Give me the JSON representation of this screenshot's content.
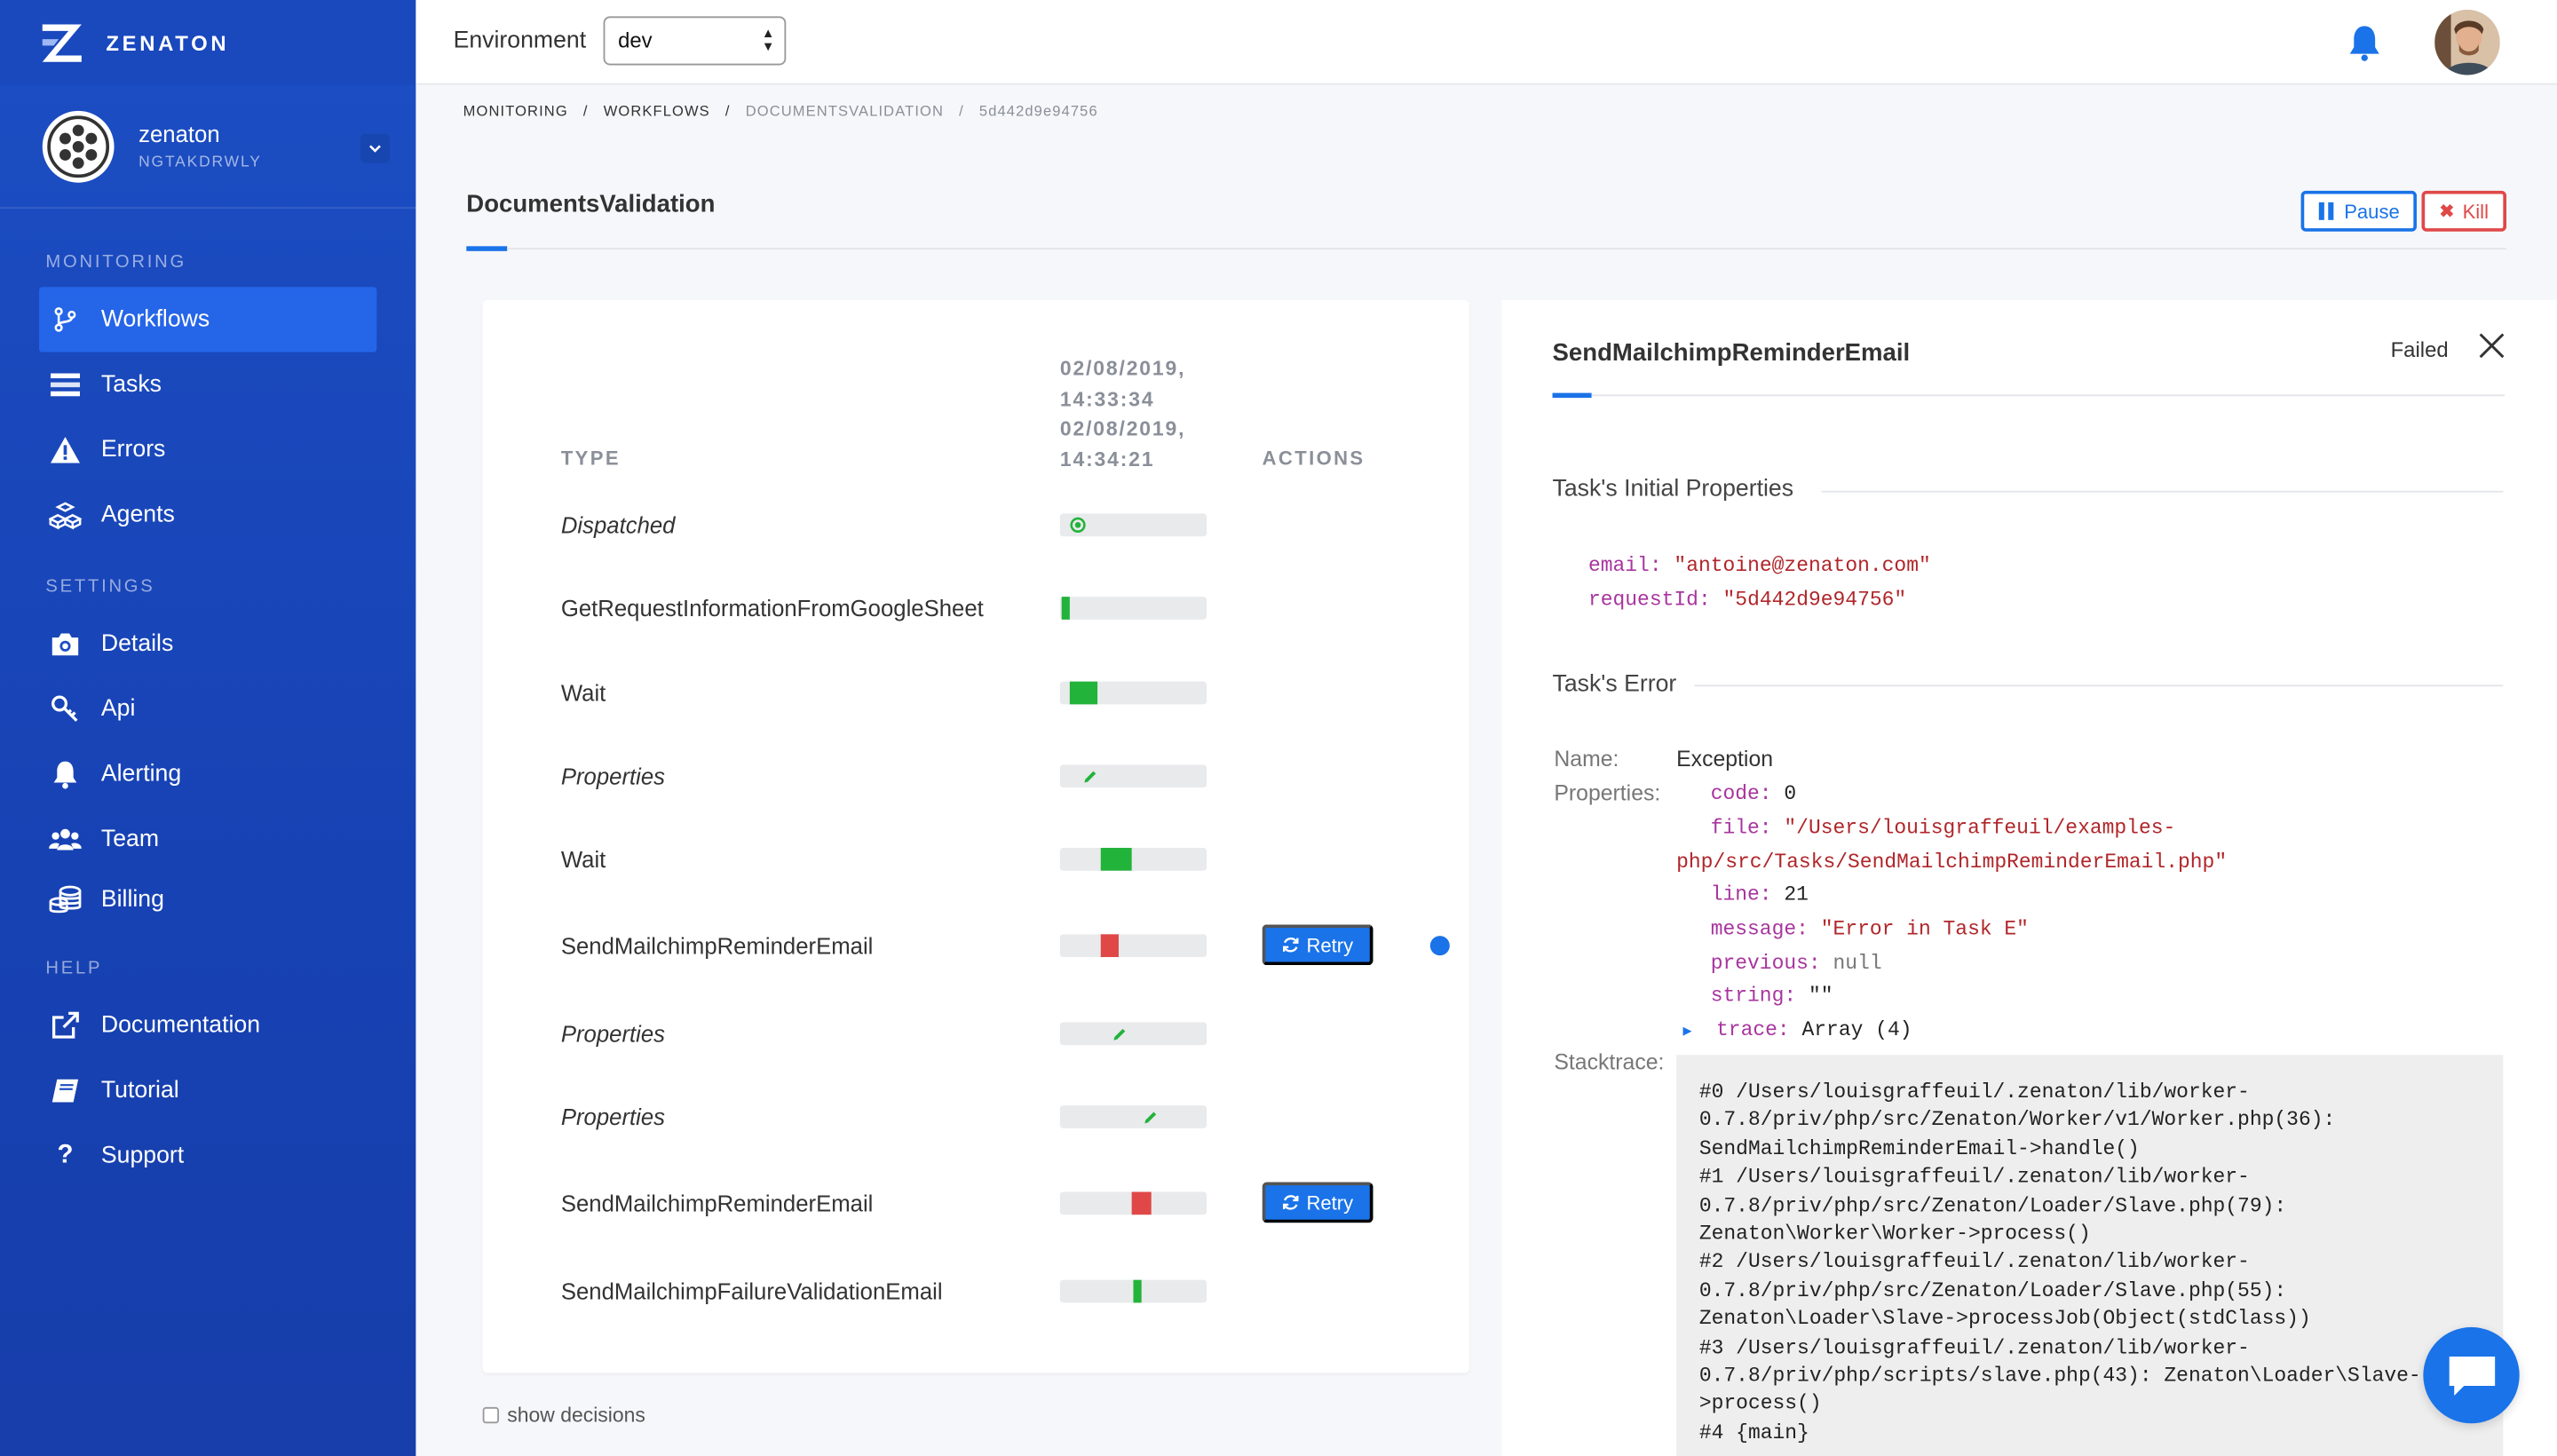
{
  "brand": {
    "name": "ZENATON"
  },
  "account": {
    "name": "zenaton",
    "id": "NGTAKDRWLY"
  },
  "sidebar": {
    "sections": [
      {
        "title": "MONITORING",
        "items": [
          {
            "label": "Workflows",
            "icon": "branch-icon",
            "active": true
          },
          {
            "label": "Tasks",
            "icon": "tasks-icon"
          },
          {
            "label": "Errors",
            "icon": "warning-icon"
          },
          {
            "label": "Agents",
            "icon": "cubes-icon"
          }
        ]
      },
      {
        "title": "SETTINGS",
        "items": [
          {
            "label": "Details",
            "icon": "camera-icon"
          },
          {
            "label": "Api",
            "icon": "key-icon"
          },
          {
            "label": "Alerting",
            "icon": "bell-icon"
          },
          {
            "label": "Team",
            "icon": "team-icon"
          },
          {
            "label": "Billing",
            "icon": "coins-icon"
          }
        ]
      },
      {
        "title": "HELP",
        "items": [
          {
            "label": "Documentation",
            "icon": "external-link-icon"
          },
          {
            "label": "Tutorial",
            "icon": "book-icon"
          },
          {
            "label": "Support",
            "icon": "question-icon"
          }
        ]
      }
    ]
  },
  "header": {
    "env_label": "Environment",
    "env_value": "dev"
  },
  "breadcrumb": [
    "MONITORING",
    "WORKFLOWS",
    "DOCUMENTSVALIDATION",
    "5d442d9e94756"
  ],
  "page": {
    "title": "DocumentsValidation",
    "pause_label": "Pause",
    "kill_label": "Kill"
  },
  "timeline": {
    "col_type": "TYPE",
    "col_actions": "ACTIONS",
    "dates": [
      "02/08/2019,",
      "14:33:34",
      "02/08/2019,",
      "14:34:21"
    ],
    "retry_label": "Retry",
    "rows": [
      {
        "name": "Dispatched",
        "italic": true,
        "kind": "start",
        "pos": 0.08
      },
      {
        "name": "GetRequestInformationFromGoogleSheet",
        "italic": false,
        "kind": "bar",
        "start": 0.01,
        "len": 0.06,
        "color": "#22b33a"
      },
      {
        "name": "Wait",
        "italic": false,
        "kind": "bar",
        "start": 0.07,
        "len": 0.19,
        "color": "#22b33a"
      },
      {
        "name": "Properties",
        "italic": true,
        "kind": "pencil",
        "pos": 0.14
      },
      {
        "name": "Wait",
        "italic": false,
        "kind": "bar",
        "start": 0.28,
        "len": 0.21,
        "color": "#22b33a"
      },
      {
        "name": "SendMailchimpReminderEmail",
        "italic": false,
        "kind": "bar",
        "start": 0.28,
        "len": 0.12,
        "color": "#e04848",
        "retry": true,
        "dot": true
      },
      {
        "name": "Properties",
        "italic": true,
        "kind": "pencil",
        "pos": 0.35
      },
      {
        "name": "Properties",
        "italic": true,
        "kind": "pencil",
        "pos": 0.56
      },
      {
        "name": "SendMailchimpReminderEmail",
        "italic": false,
        "kind": "bar",
        "start": 0.49,
        "len": 0.13,
        "color": "#e04848",
        "retry": true
      },
      {
        "name": "SendMailchimpFailureValidationEmail",
        "italic": false,
        "kind": "bar",
        "start": 0.5,
        "len": 0.06,
        "color": "#22b33a"
      }
    ],
    "show_decisions": "show decisions"
  },
  "task": {
    "title": "SendMailchimpReminderEmail",
    "status": "Failed",
    "initial_title": "Task's Initial Properties",
    "email_key": "email:",
    "email_val": "\"antoine@zenaton.com\"",
    "reqid_key": "requestId:",
    "reqid_val": "\"5d442d9e94756\"",
    "error_title": "Task's Error",
    "name_label": "Name:",
    "name_value": "Exception",
    "props_label": "Properties:",
    "code_key": "code:",
    "code_val": "0",
    "file_key": "file:",
    "file_val1": "\"/Users/louisgraffeuil/examples-",
    "file_val2": "php/src/Tasks/SendMailchimpReminderEmail.php\"",
    "line_key": "line:",
    "line_val": "21",
    "message_key": "message:",
    "message_val": "\"Error in Task E\"",
    "previous_key": "previous:",
    "previous_val": "null",
    "string_key": "string:",
    "string_val": "\"\"",
    "trace_key": "trace:",
    "trace_val": "Array (4)",
    "stack_label": "Stacktrace:",
    "stacktrace": "#0 /Users/louisgraffeuil/.zenaton/lib/worker-\n0.7.8/priv/php/src/Zenaton/Worker/v1/Worker.php(36):\nSendMailchimpReminderEmail->handle()\n#1 /Users/louisgraffeuil/.zenaton/lib/worker-\n0.7.8/priv/php/src/Zenaton/Loader/Slave.php(79):\nZenaton\\Worker\\Worker->process()\n#2 /Users/louisgraffeuil/.zenaton/lib/worker-\n0.7.8/priv/php/src/Zenaton/Loader/Slave.php(55):\nZenaton\\Loader\\Slave->processJob(Object(stdClass))\n#3 /Users/louisgraffeuil/.zenaton/lib/worker-\n0.7.8/priv/php/scripts/slave.php(43): Zenaton\\Loader\\Slave-\n>process()\n#4 {main}"
  },
  "colors": {
    "accent": "#1a73e8",
    "sidebar": "#1c4ec3",
    "success": "#22b33a",
    "danger": "#e04848"
  }
}
